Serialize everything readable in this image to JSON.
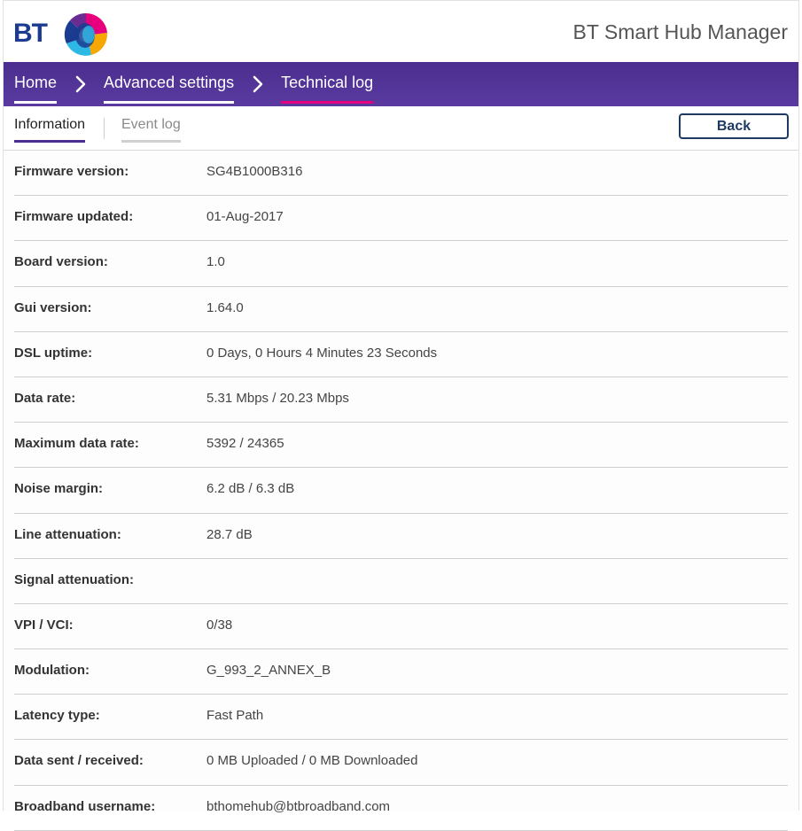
{
  "header": {
    "logo_text": "BT",
    "app_title": "BT Smart Hub Manager"
  },
  "breadcrumb": [
    {
      "label": "Home"
    },
    {
      "label": "Advanced settings"
    },
    {
      "label": "Technical log"
    }
  ],
  "tabs": [
    {
      "label": "Information",
      "selected": true
    },
    {
      "label": "Event log",
      "selected": false
    }
  ],
  "back_label": "Back",
  "info_rows": [
    {
      "label": "Firmware version:",
      "value": "SG4B1000B316"
    },
    {
      "label": "Firmware updated:",
      "value": "01-Aug-2017"
    },
    {
      "label": "Board version:",
      "value": "1.0"
    },
    {
      "label": "Gui version:",
      "value": "1.64.0"
    },
    {
      "label": "DSL uptime:",
      "value": "0 Days, 0 Hours 4 Minutes 23 Seconds"
    },
    {
      "label": "Data rate:",
      "value": "5.31 Mbps / 20.23 Mbps"
    },
    {
      "label": "Maximum data rate:",
      "value": "5392 / 24365"
    },
    {
      "label": "Noise margin:",
      "value": "6.2 dB / 6.3 dB"
    },
    {
      "label": "Line attenuation:",
      "value": "28.7 dB"
    },
    {
      "label": "Signal attenuation:",
      "value": ""
    },
    {
      "label": "VPI / VCI:",
      "value": "0/38"
    },
    {
      "label": "Modulation:",
      "value": "G_993_2_ANNEX_B"
    },
    {
      "label": "Latency type:",
      "value": "Fast Path"
    },
    {
      "label": "Data sent / received:",
      "value": "0 MB Uploaded / 0 MB Downloaded"
    },
    {
      "label": "Broadband username:",
      "value": "bthomehub@btbroadband.com"
    }
  ],
  "colors": {
    "nav_purple": "#4b2e8f",
    "active_crumb_underline": "#e6007e",
    "back_button": "#1e3a62"
  }
}
